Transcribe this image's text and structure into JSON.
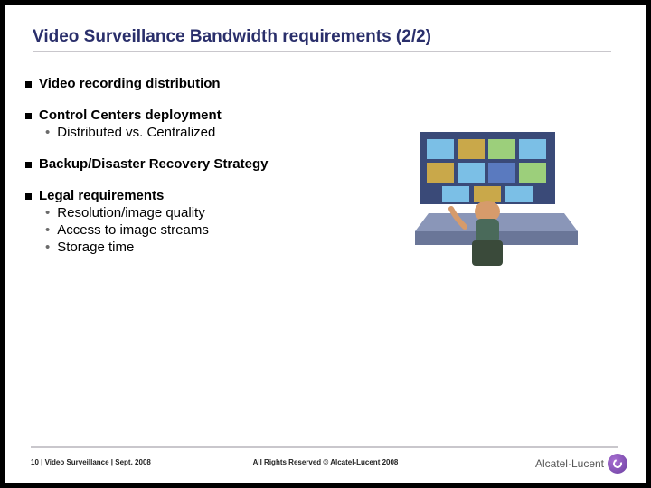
{
  "title": "Video Surveillance Bandwidth requirements (2/2)",
  "bullets": {
    "b1": "Video recording distribution",
    "b2": "Control Centers deployment",
    "b2_1": "Distributed vs. Centralized",
    "b3": "Backup/Disaster Recovery Strategy",
    "b4": "Legal requirements",
    "b4_1": "Resolution/image quality",
    "b4_2": "Access to image streams",
    "b4_3": "Storage time"
  },
  "footer": {
    "left": "10 | Video Surveillance | Sept. 2008",
    "center": "All Rights Reserved © Alcatel-Lucent 2008",
    "logo": "Alcatel·Lucent"
  },
  "illustration_alt": "control-room-operator-clipart"
}
